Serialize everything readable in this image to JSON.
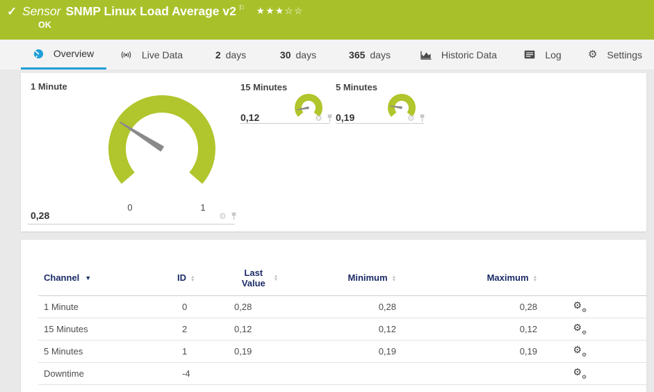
{
  "header": {
    "kind_label": "Sensor",
    "title": "SNMP Linux Load Average v2",
    "status_text": "OK",
    "rating": {
      "filled": 3,
      "total": 5,
      "stars": "★★★☆☆"
    },
    "bg_color": "#a8c12a"
  },
  "tabs": [
    {
      "label": "Overview",
      "icon": "gauge-icon",
      "active": true
    },
    {
      "label": "Live Data",
      "icon": "live-icon"
    },
    {
      "prefix": "2",
      "label": "days"
    },
    {
      "prefix": "30",
      "label": "days"
    },
    {
      "prefix": "365",
      "label": "days"
    },
    {
      "label": "Historic Data",
      "icon": "chart-icon"
    },
    {
      "label": "Log",
      "icon": "log-icon"
    },
    {
      "label": "Settings",
      "icon": "gear-icon"
    }
  ],
  "gauges": [
    {
      "title": "1 Minute",
      "value_display": "0,28",
      "min_label": "0",
      "max_label": "1",
      "size": "large"
    },
    {
      "title": "15 Minutes",
      "value_display": "0,12",
      "size": "small"
    },
    {
      "title": "5 Minutes",
      "value_display": "0,19",
      "size": "small"
    }
  ],
  "chart_data": [
    {
      "type": "gauge",
      "title": "1 Minute",
      "value": 0.28,
      "min": 0,
      "max": 1,
      "arc_sweep_deg": 262,
      "color": "#b1c52c"
    },
    {
      "type": "gauge",
      "title": "15 Minutes",
      "value": 0.12,
      "min": 0,
      "max": 1,
      "arc_sweep_deg": 262,
      "color": "#b1c52c"
    },
    {
      "type": "gauge",
      "title": "5 Minutes",
      "value": 0.19,
      "min": 0,
      "max": 1,
      "arc_sweep_deg": 262,
      "color": "#b1c52c"
    }
  ],
  "table": {
    "columns": {
      "channel": "Channel",
      "id": "ID",
      "last_value": "Last Value",
      "minimum": "Minimum",
      "maximum": "Maximum"
    },
    "sorted_by": "Channel",
    "rows": [
      {
        "channel": "1 Minute",
        "id": "0",
        "last_value": "0,28",
        "minimum": "0,28",
        "maximum": "0,28"
      },
      {
        "channel": "15 Minutes",
        "id": "2",
        "last_value": "0,12",
        "minimum": "0,12",
        "maximum": "0,12"
      },
      {
        "channel": "5 Minutes",
        "id": "1",
        "last_value": "0,19",
        "minimum": "0,19",
        "maximum": "0,19"
      },
      {
        "channel": "Downtime",
        "id": "-4",
        "last_value": "",
        "minimum": "",
        "maximum": ""
      }
    ]
  },
  "colors": {
    "accent_green": "#a8c12a",
    "gauge_green": "#b1c52c",
    "tab_blue": "#1e9fd8",
    "header_navy": "#1b2b66"
  }
}
